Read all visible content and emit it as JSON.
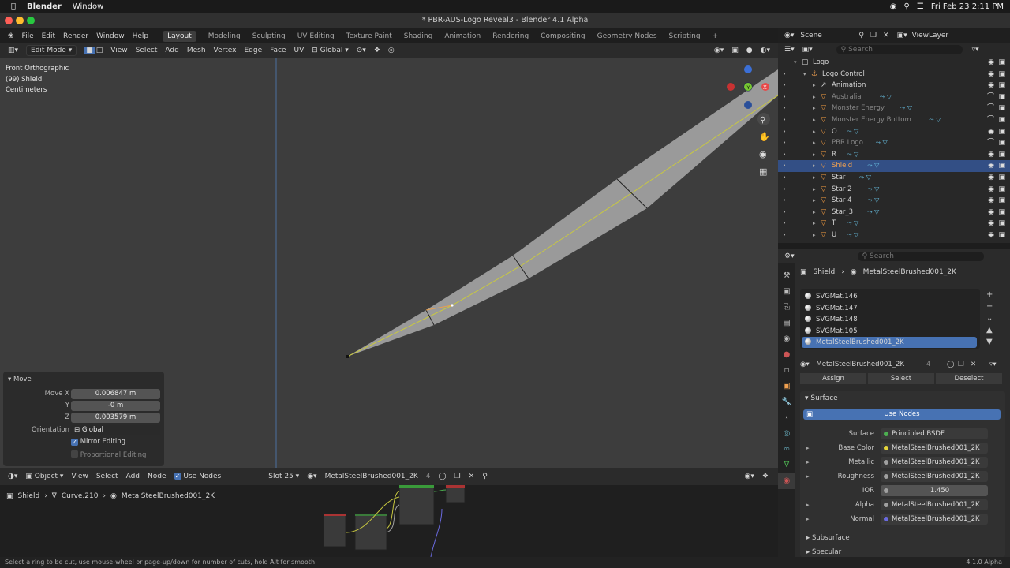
{
  "macbar": {
    "app": "Blender",
    "menu": "Window",
    "datetime": "Fri Feb 23  2:11 PM"
  },
  "window_title": "* PBR-AUS-Logo Reveal3 - Blender 4.1 Alpha",
  "top_menu": [
    "File",
    "Edit",
    "Render",
    "Window",
    "Help"
  ],
  "workspaces": [
    "Layout",
    "Modeling",
    "Sculpting",
    "UV Editing",
    "Texture Paint",
    "Shading",
    "Animation",
    "Rendering",
    "Compositing",
    "Geometry Nodes",
    "Scripting"
  ],
  "active_workspace": "Layout",
  "viewport_header": {
    "mode": "Edit Mode",
    "menus": [
      "View",
      "Select",
      "Add",
      "Mesh",
      "Vertex",
      "Edge",
      "Face",
      "UV"
    ],
    "orientation": "Global"
  },
  "viewport_info": {
    "view": "Front Orthographic",
    "object": "(99) Shield",
    "units": "Centimeters"
  },
  "move_panel": {
    "title": "Move",
    "move_x_label": "Move X",
    "move_x": "0.006847 m",
    "y_label": "Y",
    "y": "-0 m",
    "z_label": "Z",
    "z": "0.003579 m",
    "orientation_label": "Orientation",
    "orientation": "Global",
    "mirror_editing": "Mirror Editing",
    "proportional_editing": "Proportional Editing"
  },
  "node_editor": {
    "type": "Object",
    "menus": [
      "View",
      "Select",
      "Add",
      "Node"
    ],
    "use_nodes": "Use Nodes",
    "slot": "Slot 25",
    "material": "MetalSteelBrushed001_2K",
    "users": "4",
    "breadcrumb": [
      "Shield",
      "Curve.210",
      "MetalSteelBrushed001_2K"
    ]
  },
  "status": {
    "hint": "Select a ring to be cut, use mouse-wheel or page-up/down for number of cuts, hold Alt for smooth",
    "version": "4.1.0 Alpha"
  },
  "outliner": {
    "scene": "Scene",
    "view_layer": "ViewLayer",
    "search_placeholder": "Search",
    "rows": [
      {
        "name": "Logo",
        "indent": 0
      },
      {
        "name": "Logo Control",
        "indent": 1
      },
      {
        "name": "Animation",
        "indent": 2
      },
      {
        "name": "Australia",
        "indent": 2
      },
      {
        "name": "Monster Energy",
        "indent": 2
      },
      {
        "name": "Monster Energy Bottom",
        "indent": 2
      },
      {
        "name": "O",
        "indent": 2
      },
      {
        "name": "PBR Logo",
        "indent": 2
      },
      {
        "name": "R",
        "indent": 2
      },
      {
        "name": "Shield",
        "indent": 2
      },
      {
        "name": "Star",
        "indent": 2
      },
      {
        "name": "Star 2",
        "indent": 2
      },
      {
        "name": "Star 4",
        "indent": 2
      },
      {
        "name": "Star_3",
        "indent": 2
      },
      {
        "name": "T",
        "indent": 2
      },
      {
        "name": "U",
        "indent": 2
      }
    ]
  },
  "properties": {
    "search_placeholder": "Search",
    "breadcrumb_object": "Shield",
    "breadcrumb_material": "MetalSteelBrushed001_2K",
    "material_slots": [
      "SVGMat.146",
      "SVGMat.147",
      "SVGMat.148",
      "SVGMat.105",
      "MetalSteelBrushed001_2K"
    ],
    "material_name": "MetalSteelBrushed001_2K",
    "material_users": "4",
    "assign": "Assign",
    "select": "Select",
    "deselect": "Deselect",
    "surface_panel": "Surface",
    "use_nodes": "Use Nodes",
    "rows": [
      {
        "label": "Surface",
        "value": "Principled BSDF",
        "dot": "#4caf50"
      },
      {
        "label": "Base Color",
        "value": "MetalSteelBrushed001_2K",
        "dot": "#e5d53a"
      },
      {
        "label": "Metallic",
        "value": "MetalSteelBrushed001_2K",
        "dot": "#a0a0a0"
      },
      {
        "label": "Roughness",
        "value": "MetalSteelBrushed001_2K",
        "dot": "#a0a0a0"
      },
      {
        "label": "IOR",
        "value": "1.450",
        "dot": "#a0a0a0"
      },
      {
        "label": "Alpha",
        "value": "MetalSteelBrushed001_2K",
        "dot": "#a0a0a0"
      },
      {
        "label": "Normal",
        "value": "MetalSteelBrushed001_2K",
        "dot": "#6a6ae0"
      }
    ],
    "subsurface": "Subsurface",
    "specular": "Specular"
  }
}
